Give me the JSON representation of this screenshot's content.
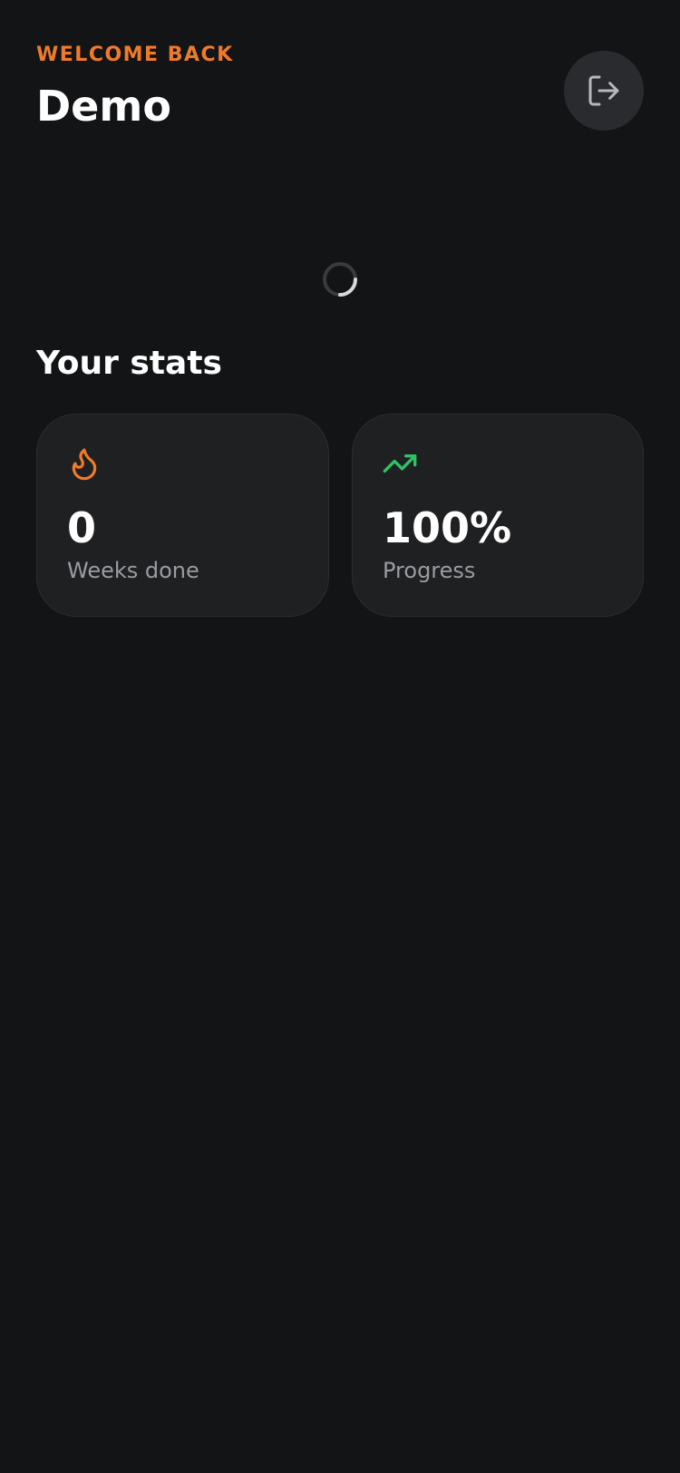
{
  "header": {
    "greeting": "WELCOME BACK",
    "username": "Demo",
    "logout_icon": "logout-icon"
  },
  "loading": {
    "icon": "loading-spinner-icon"
  },
  "stats": {
    "title": "Your stats",
    "cards": [
      {
        "icon": "flame-icon",
        "value": "0",
        "label": "Weeks done",
        "accent": "#f07a2c"
      },
      {
        "icon": "trending-up-icon",
        "value": "100%",
        "label": "Progress",
        "accent": "#2ec465"
      }
    ]
  },
  "colors": {
    "background": "#131416",
    "card": "#1f2022",
    "accent_orange": "#f07a2c",
    "accent_green": "#2ec465",
    "muted_text": "#9a9ca2"
  }
}
